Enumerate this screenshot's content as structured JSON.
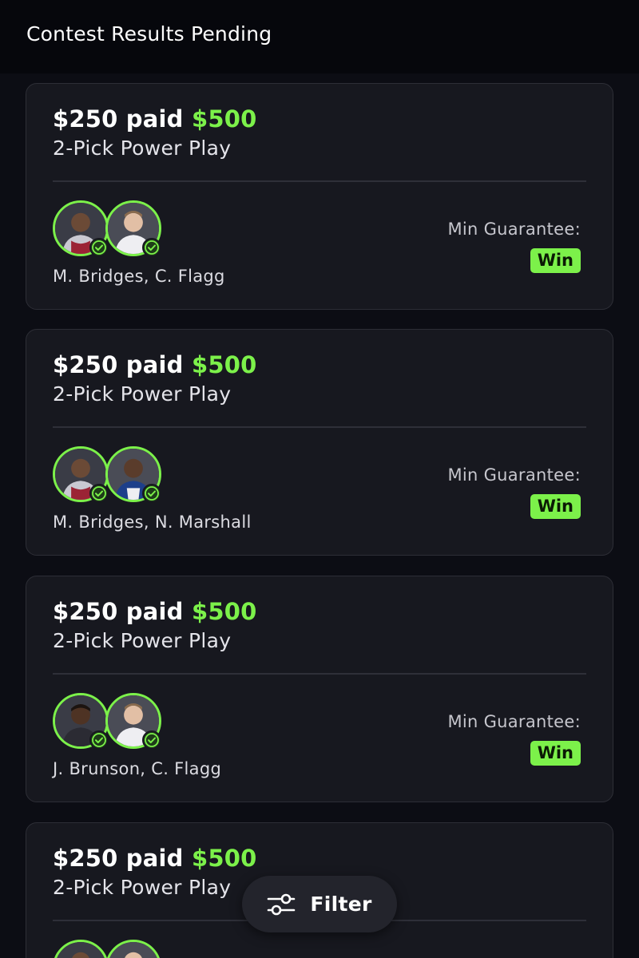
{
  "header": {
    "title": "Contest Results Pending"
  },
  "cards": [
    {
      "stake": "$250 paid",
      "payout": "$500",
      "play_type": "2-Pick Power Play",
      "players": "M. Bridges, C. Flagg",
      "min_guarantee_label": "Min Guarantee:",
      "result": "Win"
    },
    {
      "stake": "$250 paid",
      "payout": "$500",
      "play_type": "2-Pick Power Play",
      "players": "M. Bridges, N. Marshall",
      "min_guarantee_label": "Min Guarantee:",
      "result": "Win"
    },
    {
      "stake": "$250 paid",
      "payout": "$500",
      "play_type": "2-Pick Power Play",
      "players": "J. Brunson, C. Flagg",
      "min_guarantee_label": "Min Guarantee:",
      "result": "Win"
    },
    {
      "stake": "$250 paid",
      "payout": "$500",
      "play_type": "2-Pick Power Play"
    }
  ],
  "filter": {
    "label": "Filter",
    "icon": "sliders-icon"
  },
  "colors": {
    "background": "#0c0d14",
    "card": "#17181f",
    "accent_green": "#7cf14a"
  }
}
